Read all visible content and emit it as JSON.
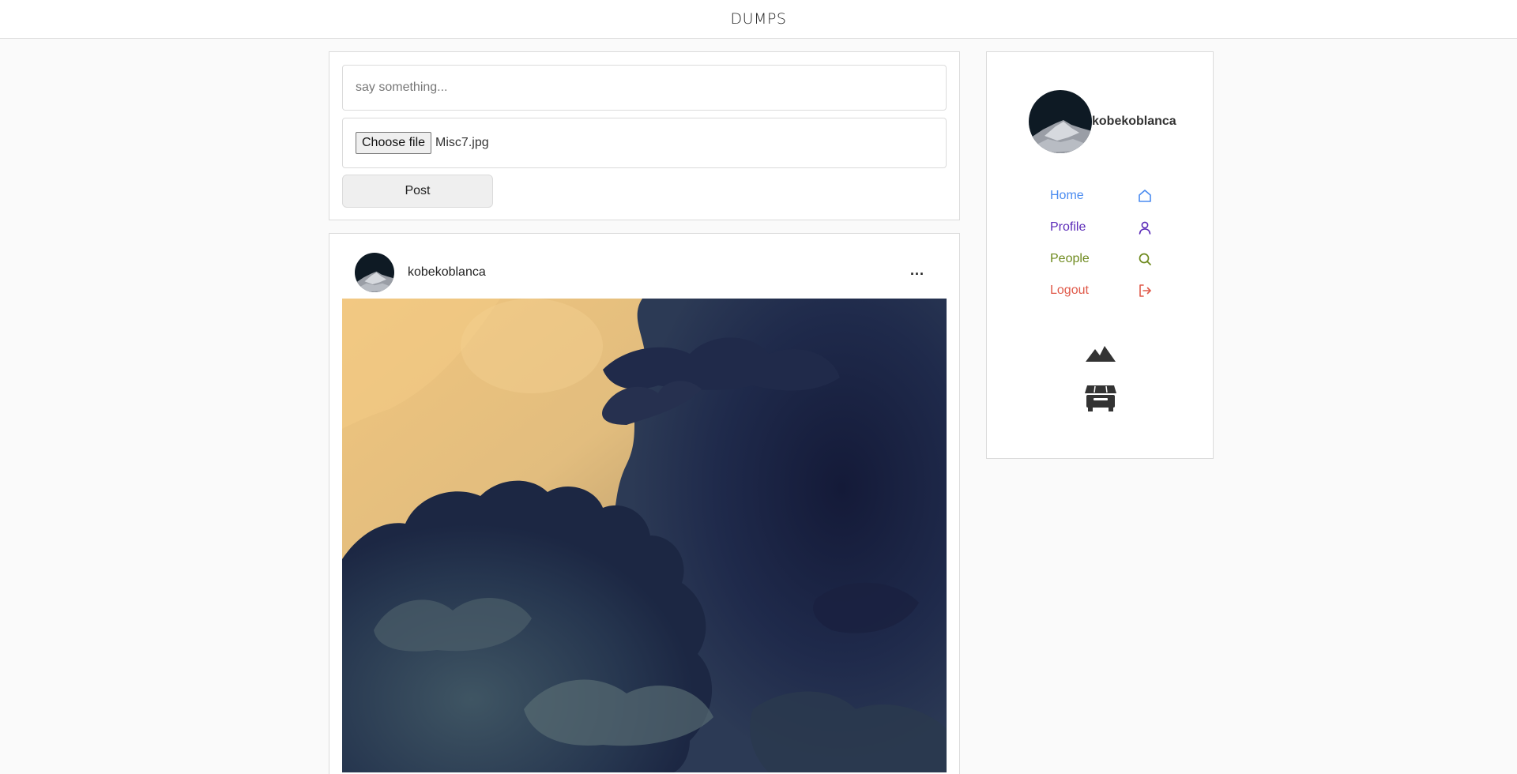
{
  "app": {
    "title": "DUMPS"
  },
  "composer": {
    "placeholder": "say something...",
    "choose_file_label": "Choose file",
    "file_name": "Misc7.jpg",
    "post_label": "Post"
  },
  "post": {
    "username": "kobekoblanca",
    "more_label": "..."
  },
  "sidebar": {
    "username": "kobekoblanca",
    "nav": [
      {
        "label": "Home",
        "icon": "home-icon",
        "color": "#4a8bf0"
      },
      {
        "label": "Profile",
        "icon": "user-icon",
        "color": "#5b2bb8"
      },
      {
        "label": "People",
        "icon": "search-icon",
        "color": "#6e8a1e"
      },
      {
        "label": "Logout",
        "icon": "logout-icon",
        "color": "#e05a4a"
      }
    ]
  },
  "colors": {
    "border": "#dbdbdb",
    "background": "#fafafa"
  }
}
